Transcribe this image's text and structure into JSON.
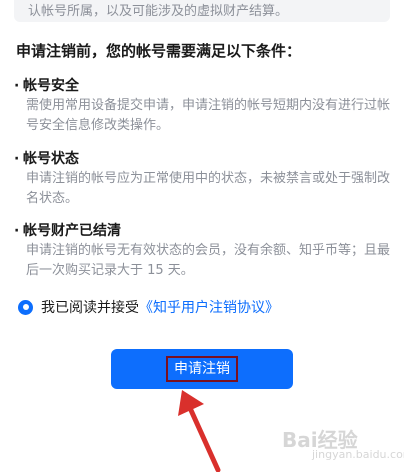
{
  "notice": {
    "text": "认帐号所属，以及可能涉及的虚拟财产结算。"
  },
  "heading": "申请注销前，您的帐号需要满足以下条件：",
  "conditions": [
    {
      "bullet": "·",
      "title": "帐号安全",
      "desc": "需使用常用设备提交申请，申请注销的帐号短期内没有进行过帐号安全信息修改类操作。"
    },
    {
      "bullet": "·",
      "title": "帐号状态",
      "desc": "申请注销的帐号应为正常使用中的状态，未被禁言或处于强制改名状态。"
    },
    {
      "bullet": "·",
      "title": "帐号财产已结清",
      "desc": "申请注销的帐号无有效状态的会员，没有余额、知乎币等；且最后一次购买记录大于 15 天。"
    }
  ],
  "agreement": {
    "text": "我已阅读并接受",
    "link": "《知乎用户注销协议》",
    "checked": true
  },
  "submit": {
    "label": "申请注销"
  },
  "watermark": {
    "main": "Bai经验",
    "sub": "jingyan.baidu.com"
  },
  "colors": {
    "accent": "#0d6efd",
    "annotation": "#d9302c"
  }
}
